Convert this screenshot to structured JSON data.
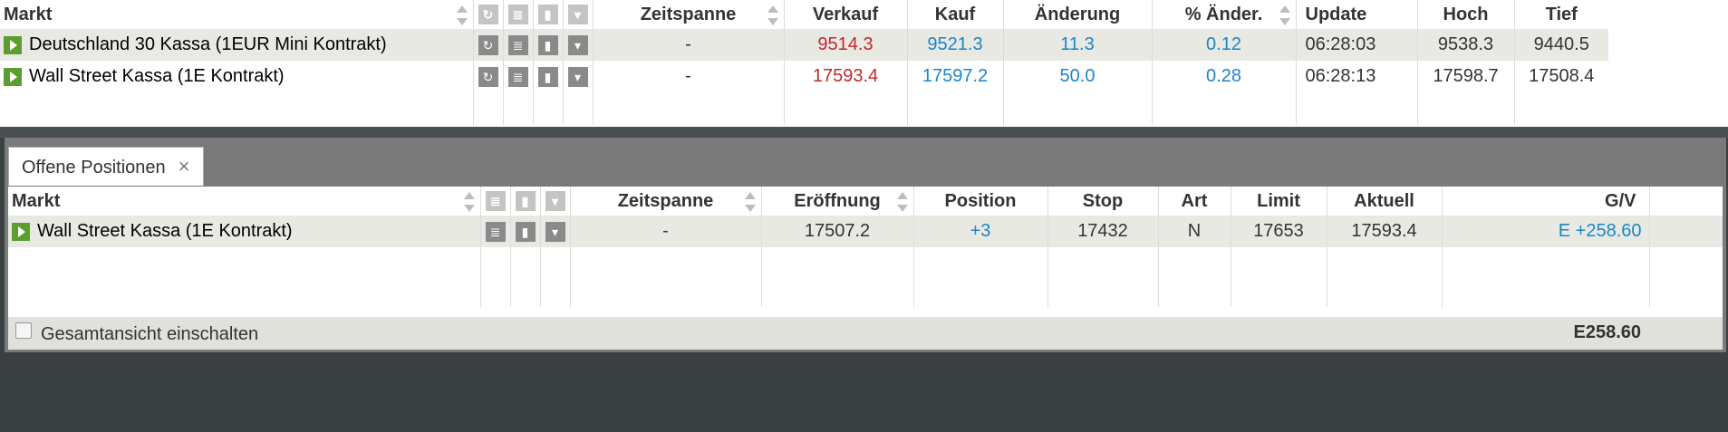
{
  "watchlist": {
    "headers": {
      "market": "Markt",
      "period": "Zeitspanne",
      "sell": "Verkauf",
      "buy": "Kauf",
      "change": "Änderung",
      "pct_change": "% Änder.",
      "update": "Update",
      "high": "Hoch",
      "low": "Tief"
    },
    "rows": [
      {
        "market": "Deutschland 30 Kassa (1EUR Mini Kontrakt)",
        "period": "-",
        "sell": "9514.3",
        "buy": "9521.3",
        "change": "11.3",
        "pct_change": "0.12",
        "update": "06:28:03",
        "high": "9538.3",
        "low": "9440.5"
      },
      {
        "market": "Wall Street Kassa (1E Kontrakt)",
        "period": "-",
        "sell": "17593.4",
        "buy": "17597.2",
        "change": "50.0",
        "pct_change": "0.28",
        "update": "06:28:13",
        "high": "17598.7",
        "low": "17508.4"
      }
    ]
  },
  "positions": {
    "tab_label": "Offene Positionen",
    "close_glyph": "×",
    "headers": {
      "market": "Markt",
      "period": "Zeitspanne",
      "open": "Eröffnung",
      "position": "Position",
      "stop": "Stop",
      "type": "Art",
      "limit": "Limit",
      "current": "Aktuell",
      "pl": "G/V"
    },
    "rows": [
      {
        "market": "Wall Street Kassa (1E Kontrakt)",
        "period": "-",
        "open": "17507.2",
        "position": "+3",
        "stop": "17432",
        "type": "N",
        "limit": "17653",
        "current": "17593.4",
        "pl": "E +258.60"
      }
    ],
    "footer": {
      "toggle_label": "Gesamtansicht einschalten",
      "total": "E258.60"
    }
  },
  "icons": [
    "play-icon",
    "refresh-icon",
    "info-icon",
    "chart-icon",
    "dropdown-icon",
    "sort-icon",
    "close-icon",
    "checkbox"
  ],
  "colors": {
    "sell": "#c0282d",
    "buy": "#1a86c8",
    "play": "#5a9e2f"
  }
}
